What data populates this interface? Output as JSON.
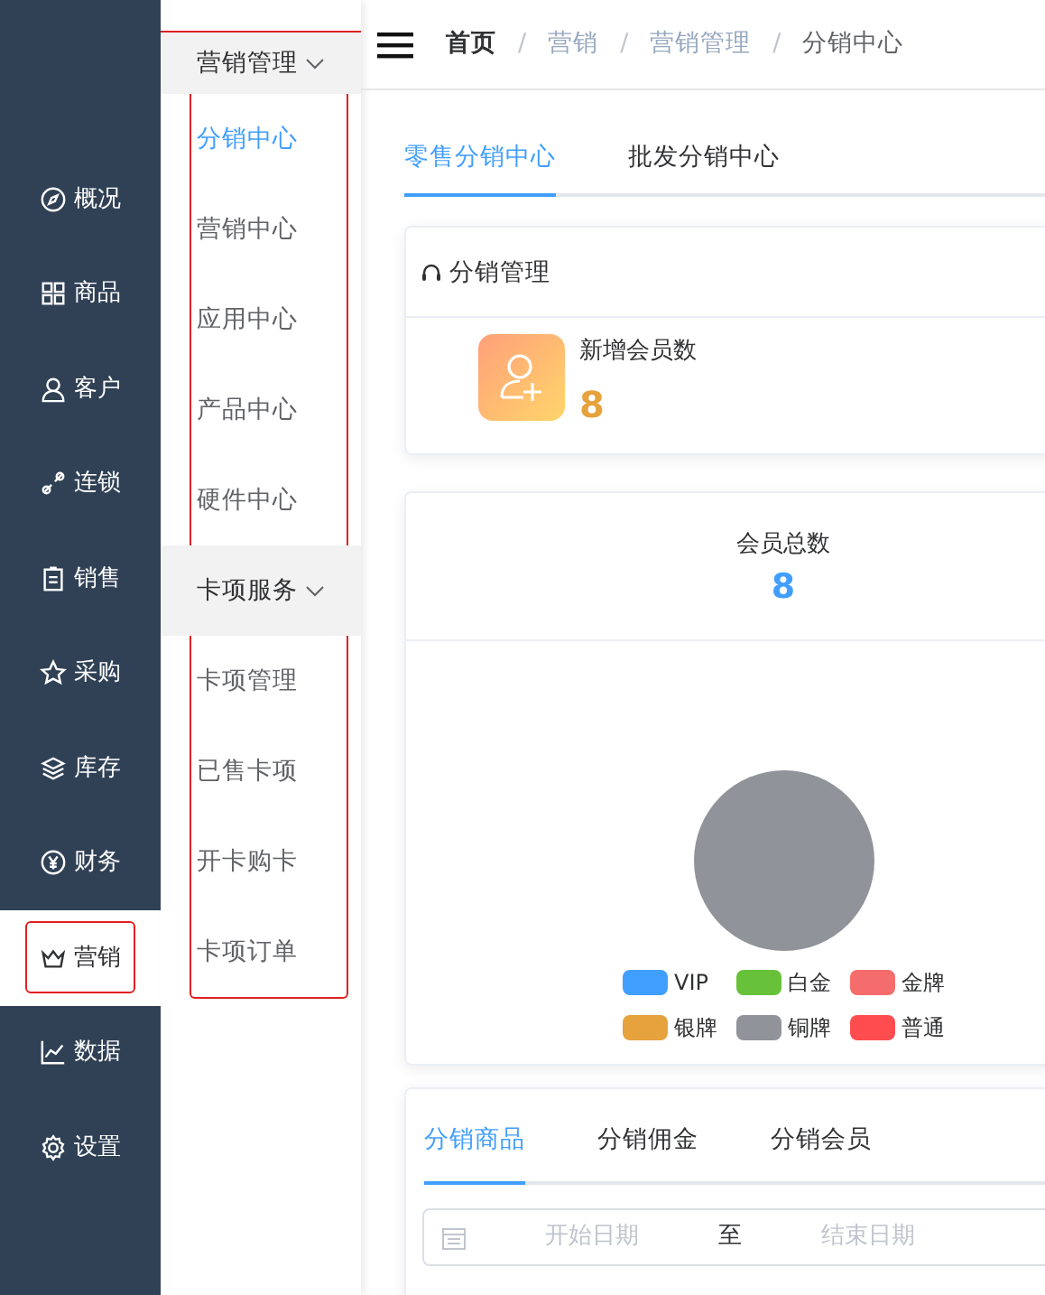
{
  "sidebar": {
    "items": [
      {
        "label": "概况",
        "selected": false
      },
      {
        "label": "商品",
        "selected": false
      },
      {
        "label": "客户",
        "selected": false
      },
      {
        "label": "连锁",
        "selected": false
      },
      {
        "label": "销售",
        "selected": false
      },
      {
        "label": "采购",
        "selected": false
      },
      {
        "label": "库存",
        "selected": false
      },
      {
        "label": "财务",
        "selected": false
      },
      {
        "label": "营销",
        "selected": true
      },
      {
        "label": "数据",
        "selected": false
      },
      {
        "label": "设置",
        "selected": false
      }
    ]
  },
  "submenu": {
    "groups": [
      {
        "title": "营销管理",
        "expanded": true,
        "items": [
          {
            "label": "分销中心",
            "selected": true
          },
          {
            "label": "营销中心",
            "selected": false
          },
          {
            "label": "应用中心",
            "selected": false
          },
          {
            "label": "产品中心",
            "selected": false
          },
          {
            "label": "硬件中心",
            "selected": false
          }
        ]
      },
      {
        "title": "卡项服务",
        "expanded": true,
        "items": [
          {
            "label": "卡项管理",
            "selected": false
          },
          {
            "label": "已售卡项",
            "selected": false
          },
          {
            "label": "开卡购卡",
            "selected": false
          },
          {
            "label": "卡项订单",
            "selected": false
          }
        ]
      }
    ]
  },
  "breadcrumb": [
    {
      "label": "首页"
    },
    {
      "separator": "/",
      "label": "营销"
    },
    {
      "separator": "/",
      "label": "营销管理"
    },
    {
      "separator": "/",
      "label": "分销中心"
    }
  ],
  "tabs": [
    {
      "label": "零售分销中心",
      "selected": true
    },
    {
      "label": "批发分销中心",
      "selected": false
    }
  ],
  "management_card": {
    "title": "分销管理",
    "stat_label": "新增会员数",
    "stat_value": "8"
  },
  "members_card": {
    "title": "会员总数",
    "value": "8",
    "legend": [
      {
        "label": "VIP",
        "color": "#409eff"
      },
      {
        "label": "白金",
        "color": "#67c23a"
      },
      {
        "label": "金牌",
        "color": "#f56c6c"
      },
      {
        "label": "银牌",
        "color": "#e6a23c"
      },
      {
        "label": "铜牌",
        "color": "#909399"
      },
      {
        "label": "普通",
        "color": "#ff4d4f"
      }
    ]
  },
  "bottom_tabs": [
    {
      "label": "分销商品",
      "selected": true
    },
    {
      "label": "分销佣金",
      "selected": false
    },
    {
      "label": "分销会员",
      "selected": false
    }
  ],
  "date_range": {
    "start_placeholder": "开始日期",
    "separator": "至",
    "end_placeholder": "结束日期"
  }
}
